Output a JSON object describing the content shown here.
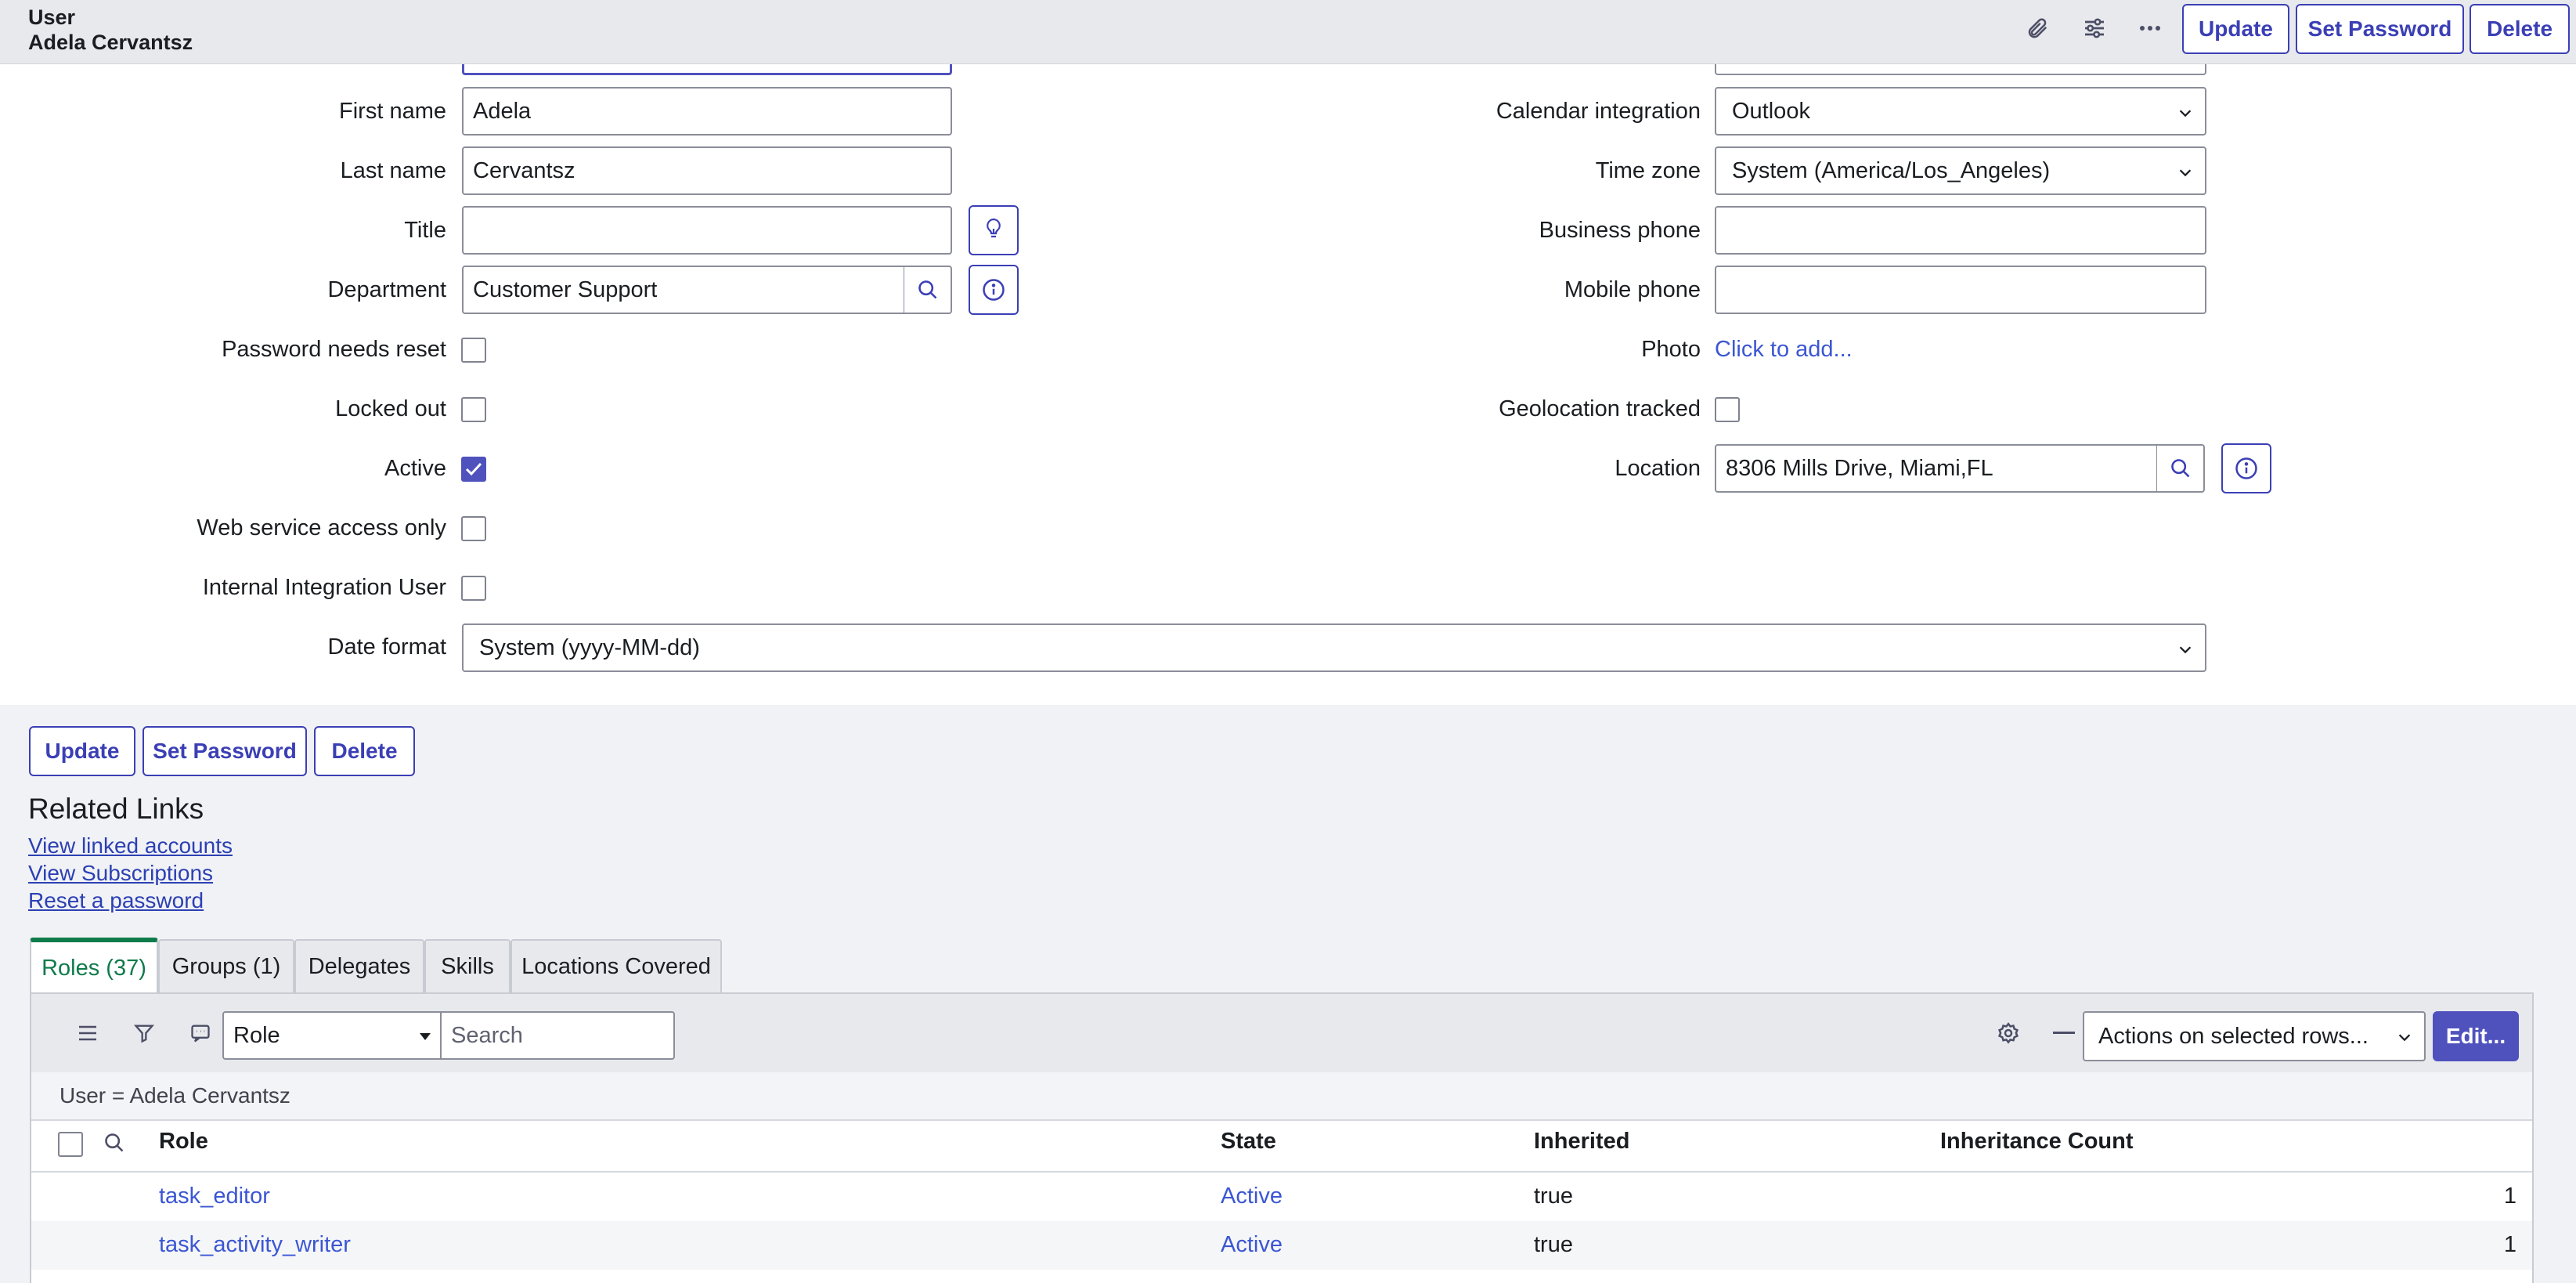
{
  "header": {
    "record_type": "User",
    "record_name": "Adela Cervantsz",
    "icons": [
      "paperclip-icon",
      "sliders-icon",
      "more-icon"
    ],
    "buttons": {
      "update": "Update",
      "set_password": "Set Password",
      "delete": "Delete"
    }
  },
  "form": {
    "first_name": {
      "label": "First name",
      "value": "Adela"
    },
    "last_name": {
      "label": "Last name",
      "value": "Cervantsz"
    },
    "title": {
      "label": "Title",
      "value": ""
    },
    "department": {
      "label": "Department",
      "value": "Customer Support"
    },
    "password_needs_reset": {
      "label": "Password needs reset",
      "checked": false
    },
    "locked_out": {
      "label": "Locked out",
      "checked": false
    },
    "active": {
      "label": "Active",
      "checked": true
    },
    "web_service_access_only": {
      "label": "Web service access only",
      "checked": false
    },
    "internal_integration_user": {
      "label": "Internal Integration User",
      "checked": false
    },
    "date_format": {
      "label": "Date format",
      "value": "System (yyyy-MM-dd)"
    },
    "calendar_integration": {
      "label": "Calendar integration",
      "value": "Outlook"
    },
    "time_zone": {
      "label": "Time zone",
      "value": "System (America/Los_Angeles)"
    },
    "business_phone": {
      "label": "Business phone",
      "value": ""
    },
    "mobile_phone": {
      "label": "Mobile phone",
      "value": ""
    },
    "photo": {
      "label": "Photo",
      "link": "Click to add..."
    },
    "geolocation_tracked": {
      "label": "Geolocation tracked",
      "checked": false
    },
    "location": {
      "label": "Location",
      "value": "8306 Mills Drive, Miami,FL"
    }
  },
  "bottom_buttons": {
    "update": "Update",
    "set_password": "Set Password",
    "delete": "Delete"
  },
  "related_links": {
    "title": "Related Links",
    "links": [
      "View linked accounts",
      "View Subscriptions",
      "Reset a password"
    ]
  },
  "tabs": [
    "Roles (37)",
    "Groups (1)",
    "Delegates",
    "Skills",
    "Locations Covered"
  ],
  "active_tab": "Roles (37)",
  "list": {
    "filter_field": "Role",
    "search_placeholder": "Search",
    "actions_select": "Actions on selected rows...",
    "edit_button": "Edit...",
    "breadcrumb": "User = Adela Cervantsz",
    "columns": [
      "Role",
      "State",
      "Inherited",
      "Inheritance Count"
    ],
    "rows": [
      {
        "role": "task_editor",
        "state": "Active",
        "inherited": "true",
        "count": "1"
      },
      {
        "role": "task_activity_writer",
        "state": "Active",
        "inherited": "true",
        "count": "1"
      }
    ]
  },
  "colors": {
    "accent": "#4f52bd",
    "link": "#3b56d3",
    "active_tab": "#0e7b4a"
  }
}
